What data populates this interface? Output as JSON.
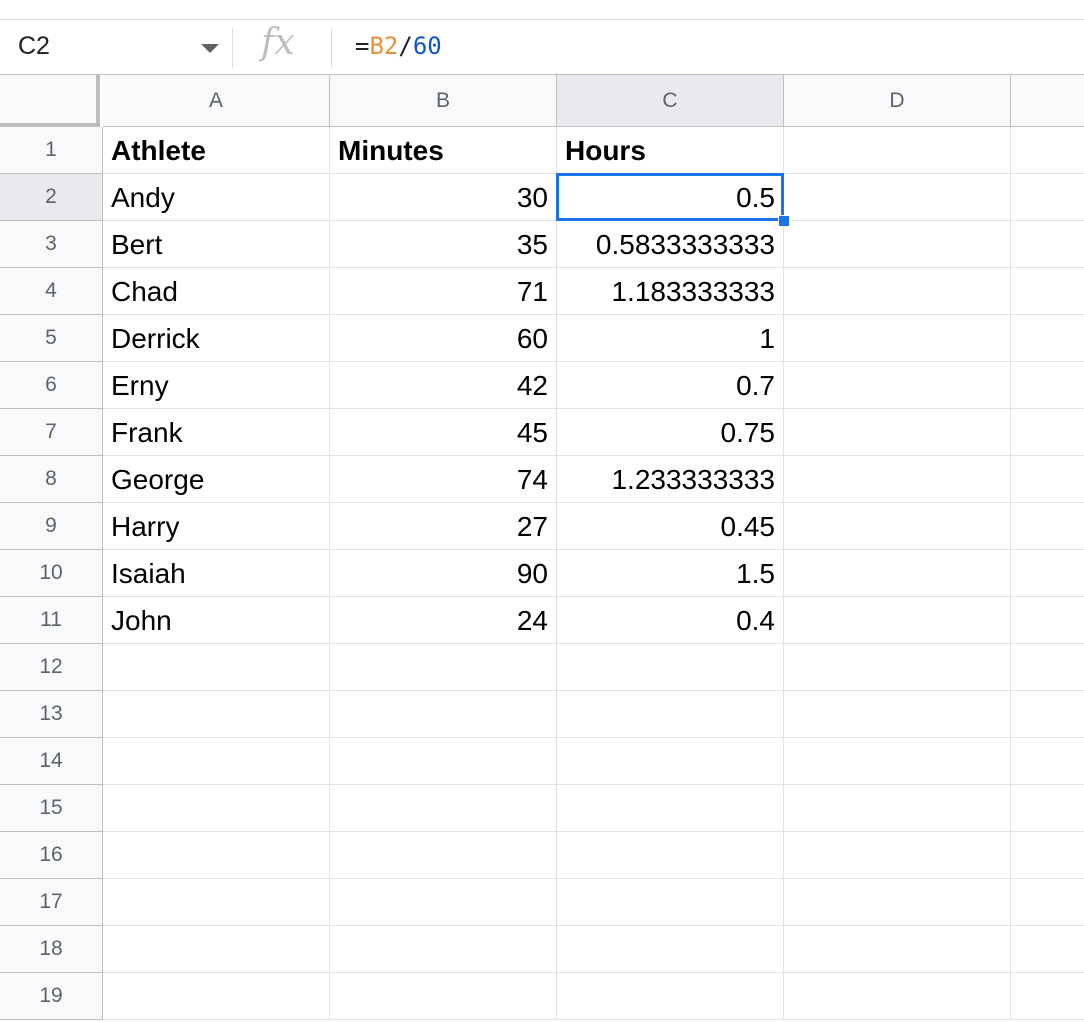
{
  "formula_bar": {
    "name_box": "C2",
    "fx_label": "fx",
    "formula_parts": [
      {
        "text": "=",
        "color": "#202124"
      },
      {
        "text": "B2",
        "color": "#e69138"
      },
      {
        "text": "/",
        "color": "#202124"
      },
      {
        "text": "60",
        "color": "#1155cc"
      }
    ]
  },
  "columns": [
    "A",
    "B",
    "C",
    "D",
    ""
  ],
  "selected_column": "C",
  "selected_row": "2",
  "selected_cell": "C2",
  "rows": [
    {
      "n": "1",
      "cells": [
        "Athlete",
        "Minutes",
        "Hours",
        "",
        ""
      ],
      "bold": true
    },
    {
      "n": "2",
      "cells": [
        "Andy",
        "30",
        "0.5",
        "",
        ""
      ]
    },
    {
      "n": "3",
      "cells": [
        "Bert",
        "35",
        "0.5833333333",
        "",
        ""
      ]
    },
    {
      "n": "4",
      "cells": [
        "Chad",
        "71",
        "1.183333333",
        "",
        ""
      ]
    },
    {
      "n": "5",
      "cells": [
        "Derrick",
        "60",
        "1",
        "",
        ""
      ]
    },
    {
      "n": "6",
      "cells": [
        "Erny",
        "42",
        "0.7",
        "",
        ""
      ]
    },
    {
      "n": "7",
      "cells": [
        "Frank",
        "45",
        "0.75",
        "",
        ""
      ]
    },
    {
      "n": "8",
      "cells": [
        "George",
        "74",
        "1.233333333",
        "",
        ""
      ]
    },
    {
      "n": "9",
      "cells": [
        "Harry",
        "27",
        "0.45",
        "",
        ""
      ]
    },
    {
      "n": "10",
      "cells": [
        "Isaiah",
        "90",
        "1.5",
        "",
        ""
      ]
    },
    {
      "n": "11",
      "cells": [
        "John",
        "24",
        "0.4",
        "",
        ""
      ]
    },
    {
      "n": "12",
      "cells": [
        "",
        "",
        "",
        "",
        ""
      ]
    },
    {
      "n": "13",
      "cells": [
        "",
        "",
        "",
        "",
        ""
      ]
    },
    {
      "n": "14",
      "cells": [
        "",
        "",
        "",
        "",
        ""
      ]
    },
    {
      "n": "15",
      "cells": [
        "",
        "",
        "",
        "",
        ""
      ]
    },
    {
      "n": "16",
      "cells": [
        "",
        "",
        "",
        "",
        ""
      ]
    },
    {
      "n": "17",
      "cells": [
        "",
        "",
        "",
        "",
        ""
      ]
    },
    {
      "n": "18",
      "cells": [
        "",
        "",
        "",
        "",
        ""
      ]
    },
    {
      "n": "19",
      "cells": [
        "",
        "",
        "",
        "",
        ""
      ]
    }
  ],
  "colors": {
    "selection": "#1a73e8",
    "header_bg": "#f8f9fa",
    "header_selected_bg": "#e8eaed"
  }
}
